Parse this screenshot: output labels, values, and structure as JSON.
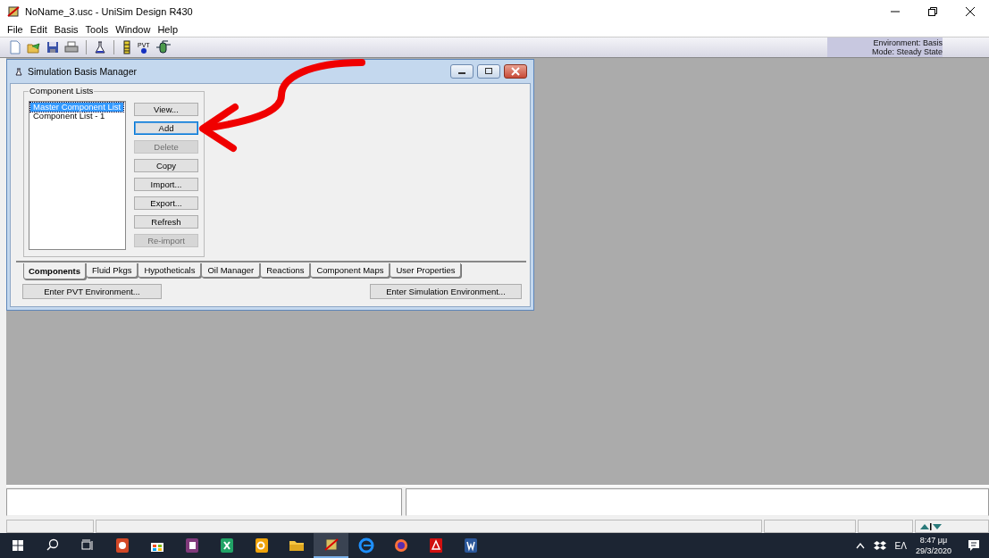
{
  "window": {
    "title": "NoName_3.usc - UniSim Design R430"
  },
  "menu": [
    "File",
    "Edit",
    "Basis",
    "Tools",
    "Window",
    "Help"
  ],
  "toolbar": {
    "pvt_label": "PVT",
    "environment": "Environment: Basis",
    "mode": "Mode: Steady State"
  },
  "basis_manager": {
    "title": "Simulation Basis Manager",
    "group_label": "Component Lists",
    "lists": [
      {
        "label": "Master Component List",
        "selected": true
      },
      {
        "label": "Component List - 1",
        "selected": false
      }
    ],
    "buttons": [
      {
        "label": "View...",
        "disabled": false,
        "focused": false
      },
      {
        "label": "Add",
        "disabled": false,
        "focused": true
      },
      {
        "label": "Delete",
        "disabled": true,
        "focused": false
      },
      {
        "label": "Copy",
        "disabled": false,
        "focused": false
      },
      {
        "label": "Import...",
        "disabled": false,
        "focused": false
      },
      {
        "label": "Export...",
        "disabled": false,
        "focused": false
      },
      {
        "label": "Refresh",
        "disabled": false,
        "focused": false
      },
      {
        "label": "Re-import",
        "disabled": true,
        "focused": false
      }
    ],
    "tabs": [
      {
        "label": "Components",
        "selected": true
      },
      {
        "label": "Fluid Pkgs",
        "selected": false
      },
      {
        "label": "Hypotheticals",
        "selected": false
      },
      {
        "label": "Oil Manager",
        "selected": false
      },
      {
        "label": "Reactions",
        "selected": false
      },
      {
        "label": "Component Maps",
        "selected": false
      },
      {
        "label": "User Properties",
        "selected": false
      }
    ],
    "footer_buttons": [
      "Enter PVT Environment...",
      "Enter Simulation Environment..."
    ]
  },
  "taskbar": {
    "apps": [
      {
        "kind": "powerpoint",
        "active": false
      },
      {
        "kind": "store",
        "active": false
      },
      {
        "kind": "onenote",
        "active": false
      },
      {
        "kind": "excel",
        "active": false
      },
      {
        "kind": "outlook",
        "active": false
      },
      {
        "kind": "folder",
        "active": false
      },
      {
        "kind": "unisim",
        "active": true
      },
      {
        "kind": "edge",
        "active": false
      },
      {
        "kind": "firefox",
        "active": false
      },
      {
        "kind": "acrobat",
        "active": false
      },
      {
        "kind": "word",
        "active": false
      }
    ],
    "language": "ΕΛ",
    "time": "8:47 μμ",
    "date": "29/3/2020"
  }
}
